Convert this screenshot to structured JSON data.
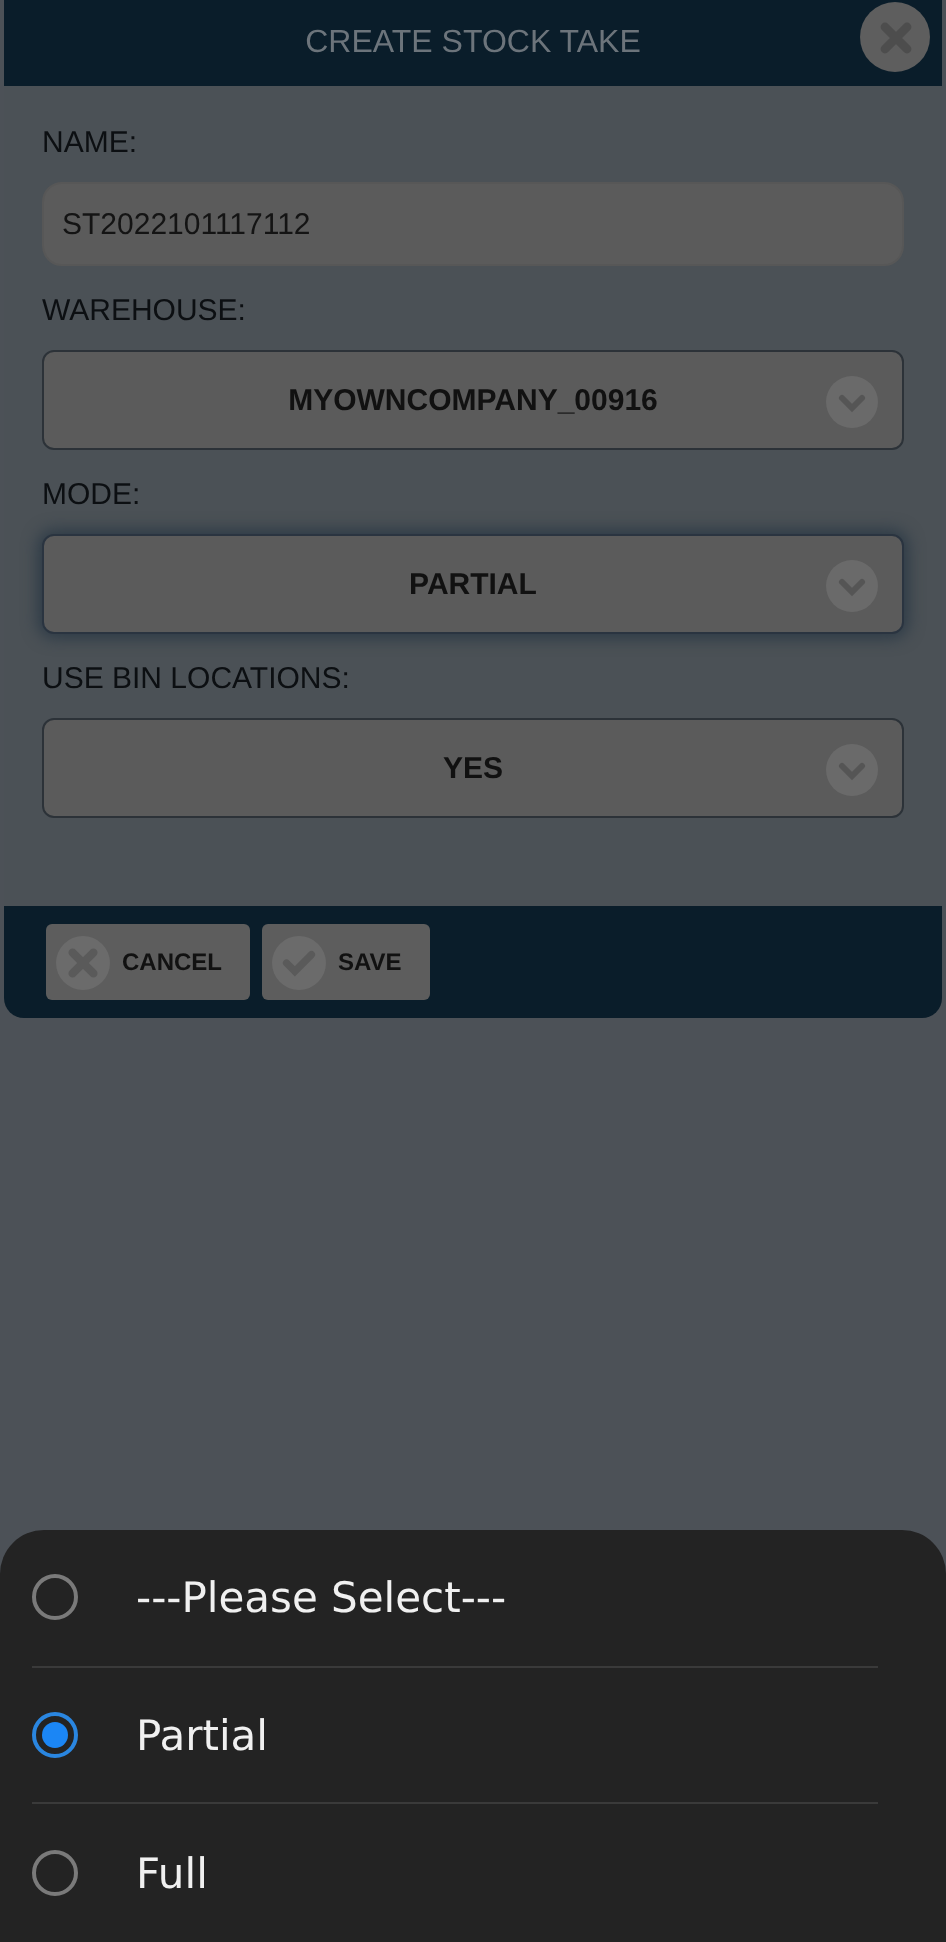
{
  "dialog": {
    "title": "CREATE STOCK TAKE",
    "name_field": {
      "label": "NAME:",
      "value": "ST2022101117112"
    },
    "selects": [
      {
        "label": "WAREHOUSE:",
        "value": "MYOWNCOMPANY_00916",
        "focused": false
      },
      {
        "label": "MODE:",
        "value": "PARTIAL",
        "focused": true
      },
      {
        "label": "USE BIN LOCATIONS:",
        "value": "YES",
        "focused": false
      }
    ],
    "buttons": [
      {
        "kind": "cancel",
        "label": "CANCEL"
      },
      {
        "kind": "save",
        "label": "SAVE"
      }
    ]
  },
  "picker": {
    "options": [
      {
        "label": "---Please Select---",
        "selected": false
      },
      {
        "label": "Partial",
        "selected": true
      },
      {
        "label": "Full",
        "selected": false
      }
    ]
  }
}
